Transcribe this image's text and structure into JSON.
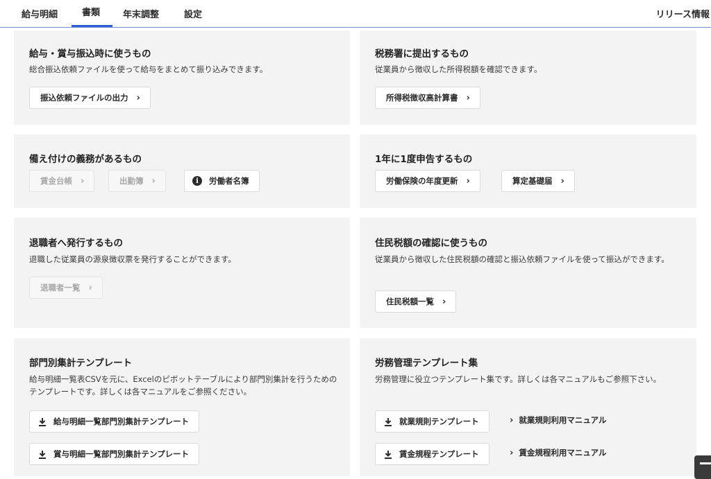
{
  "nav": {
    "tabs": [
      {
        "label": "給与明細"
      },
      {
        "label": "書類"
      },
      {
        "label": "年末調整"
      },
      {
        "label": "設定"
      }
    ],
    "active_tab": "書類",
    "release_info": "リリース情報"
  },
  "cards": {
    "transfer": {
      "title": "給与・賞与振込時に使うもの",
      "desc": "総合振込依頼ファイルを使って給与をまとめて振り込みできます。",
      "button": "振込依頼ファイルの出力"
    },
    "tax_office": {
      "title": "税務署に提出するもの",
      "desc": "従業員から徴収した所得税額を確認できます。",
      "button": "所得税徴収高計算書"
    },
    "obligation": {
      "title": "備え付けの義務があるもの",
      "btn_wage_ledger": "賃金台帳",
      "btn_attendance": "出勤簿",
      "btn_worker_roster": "労働者名簿"
    },
    "annual": {
      "title": "1年に1度申告するもの",
      "btn_labor_insurance": "労働保険の年度更新",
      "btn_calc_base": "算定基礎届"
    },
    "retiree": {
      "title": "退職者へ発行するもの",
      "desc": "退職した従業員の源泉徴収票を発行することができます。",
      "button": "退職者一覧"
    },
    "resident_tax": {
      "title": "住民税額の確認に使うもの",
      "desc": "従業員から徴収した住民税額の確認と振込依頼ファイルを使って振込ができます。",
      "button": "住民税額一覧"
    },
    "dept_template": {
      "title": "部門別集計テンプレート",
      "desc": "給与明細一覧表CSVを元に、Excelのピボットテーブルにより部門別集計を行うためのテンプレートです。詳しくは各マニュアルをご参照ください。",
      "btn_salary": "給与明細一覧部門別集計テンプレート",
      "btn_bonus": "賞与明細一覧部門別集計テンプレート"
    },
    "labor_template": {
      "title": "労務管理テンプレート集",
      "desc": "労務管理に役立つテンプレート集です。詳しくは各マニュアルもご参照下さい。",
      "btn_work_rules": "就業規則テンプレート",
      "link_work_rules": "就業規則利用マニュアル",
      "btn_wage_rules": "賃金規程テンプレート",
      "link_wage_rules": "賃金規程利用マニュアル"
    }
  },
  "icons": {
    "chevron": "›",
    "info": "i"
  },
  "colors": {
    "accent": "#2f5bd3",
    "card_bg": "#f4f3f3",
    "disabled_text": "#a9a9a9"
  }
}
